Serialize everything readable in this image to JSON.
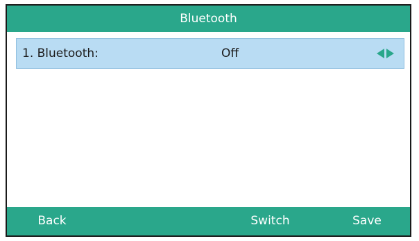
{
  "title_bar": {
    "title": "Bluetooth"
  },
  "menu": {
    "items": [
      {
        "label": "1. Bluetooth:",
        "value": "Off",
        "icon_left": "arrow-left-icon",
        "icon_right": "arrow-right-icon"
      }
    ]
  },
  "softkeys": {
    "back": "Back",
    "switch": "Switch",
    "save": "Save"
  },
  "colors": {
    "accent": "#2aa78b",
    "selected_row": "#b9dcf3",
    "text": "#1a1a1a"
  }
}
